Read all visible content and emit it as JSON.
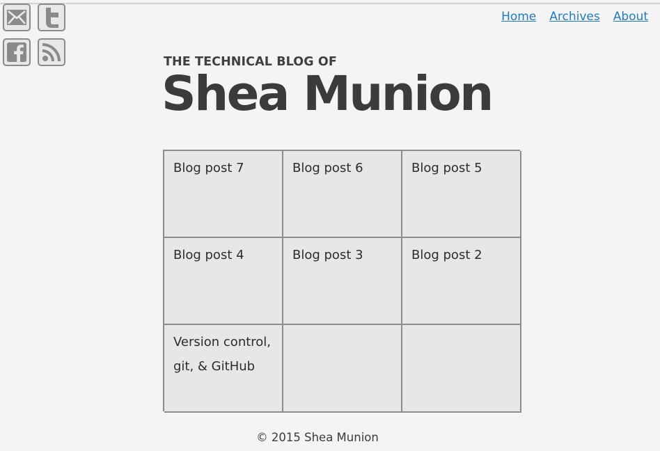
{
  "social": {
    "email_icon": "envelope-icon",
    "twitter_icon": "twitter-icon",
    "facebook_icon": "facebook-icon",
    "rss_icon": "rss-icon"
  },
  "nav": {
    "items": [
      {
        "label": "Home"
      },
      {
        "label": "Archives"
      },
      {
        "label": "About"
      }
    ]
  },
  "header": {
    "kicker": "THE TECHNICAL BLOG OF",
    "title": "Shea Munion"
  },
  "posts": [
    {
      "title": "Blog post 7"
    },
    {
      "title": "Blog post 6"
    },
    {
      "title": "Blog post 5"
    },
    {
      "title": "Blog post 4"
    },
    {
      "title": "Blog post 3"
    },
    {
      "title": "Blog post 2"
    },
    {
      "title": "Version control, git, & GitHub"
    },
    {
      "title": ""
    },
    {
      "title": ""
    }
  ],
  "footer": {
    "copyright": "© 2015 Shea Munion"
  },
  "colors": {
    "background": "#f4f4f4",
    "link": "#1f7bc1",
    "cell_bg": "#e7e7e7",
    "border": "#8c8c8c",
    "text": "#3a3a3a"
  }
}
